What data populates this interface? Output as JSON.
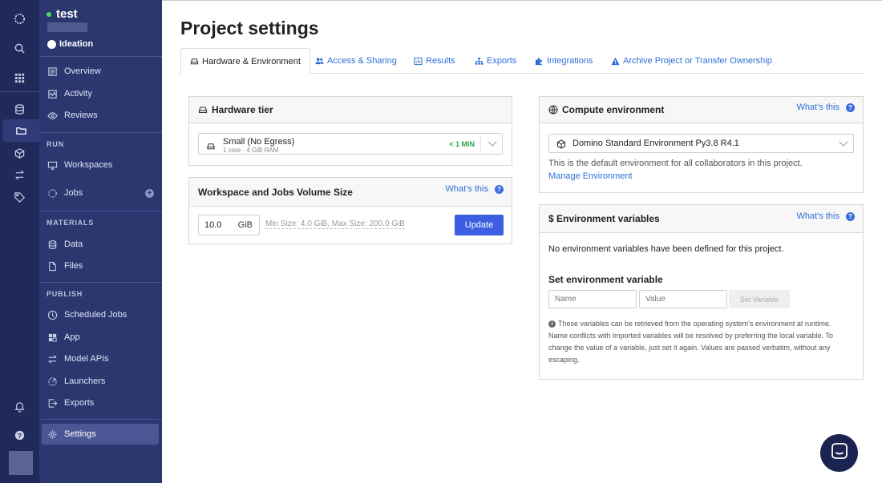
{
  "rail": {
    "icons": [
      "domino-logo-icon",
      "search-icon",
      "apps-grid-icon",
      "database-icon",
      "folder-icon",
      "cube-icon",
      "swap-icon",
      "tag-icon",
      "bell-icon",
      "help-icon"
    ]
  },
  "project": {
    "name": "test",
    "stage": "Ideation"
  },
  "sidebar": {
    "top_items": [
      {
        "label": "Overview"
      },
      {
        "label": "Activity"
      },
      {
        "label": "Reviews"
      }
    ],
    "run_label": "RUN",
    "run_items": [
      {
        "label": "Workspaces"
      },
      {
        "label": "Jobs"
      }
    ],
    "materials_label": "MATERIALS",
    "materials_items": [
      {
        "label": "Data"
      },
      {
        "label": "Files"
      }
    ],
    "publish_label": "PUBLISH",
    "publish_items": [
      {
        "label": "Scheduled Jobs"
      },
      {
        "label": "App"
      },
      {
        "label": "Model APIs"
      },
      {
        "label": "Launchers"
      },
      {
        "label": "Exports"
      }
    ],
    "settings_label": "Settings"
  },
  "page": {
    "title": "Project settings",
    "tabs": [
      {
        "label": "Hardware & Environment"
      },
      {
        "label": "Access & Sharing"
      },
      {
        "label": "Results"
      },
      {
        "label": "Exports"
      },
      {
        "label": "Integrations"
      },
      {
        "label": "Archive Project or Transfer Ownership"
      }
    ]
  },
  "hardware": {
    "title": "Hardware tier",
    "tier_name": "Small (No Egress)",
    "tier_spec": "1 core · 4 GiB RAM",
    "tier_time": "< 1 MIN"
  },
  "volume": {
    "title": "Workspace and Jobs Volume Size",
    "whats_this": "What's this",
    "value": "10.0",
    "unit": "GiB",
    "hint": "Min Size: 4.0 GiB, Max Size: 200.0 GiB",
    "update_label": "Update"
  },
  "compute": {
    "title": "Compute environment",
    "whats_this": "What's this",
    "env_name": "Domino Standard Environment Py3.8 R4.1",
    "description": "This is the default environment for all collaborators in this project.",
    "manage_link": "Manage Environment"
  },
  "envvars": {
    "title": "$ Environment variables",
    "whats_this": "What's this",
    "empty_text": "No environment variables have been defined for this project.",
    "set_title": "Set environment variable",
    "name_placeholder": "Name",
    "value_placeholder": "Value",
    "set_label": "Set Variable",
    "info_lines": [
      "These variables can be retrieved from the operating system's environment at runtime.",
      "Name conflicts with imported variables will be resolved by preferring the local variable. To",
      "change the value of a variable, just set it again. Values are passed verbatim, without any",
      "escaping."
    ]
  },
  "colors": {
    "rail": "#1f2a5a",
    "sidebar": "#2b3870",
    "accent": "#3b5fe0",
    "link": "#2f6fd6",
    "online": "#4cd964",
    "time_badge": "#2ca84a"
  }
}
